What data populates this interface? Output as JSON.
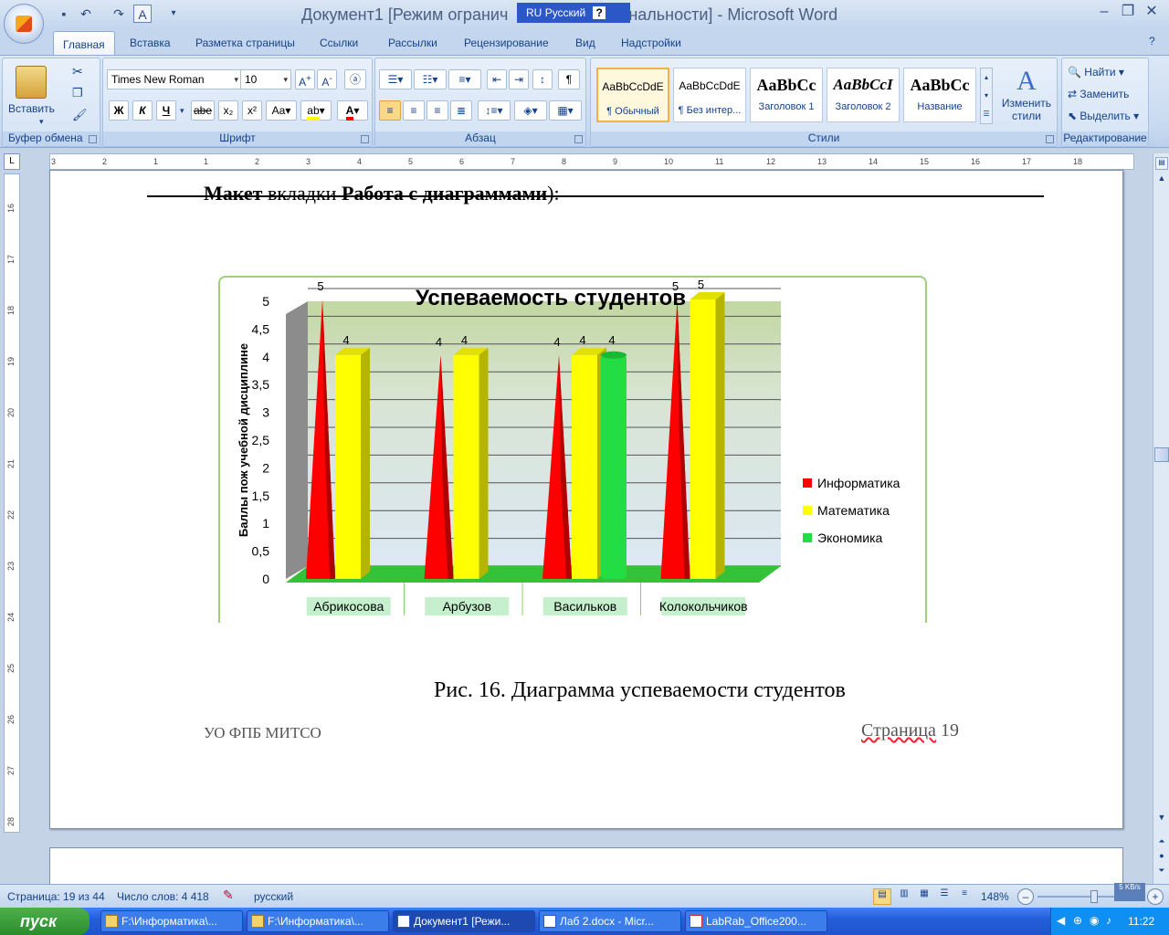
{
  "titlebar": {
    "document_title": "Документ1 [Режим ограниченной функциональности] - Microsoft Word",
    "title_part1": "Документ1 [Режим огранич",
    "title_part2": "ональности]  -  Microsoft Word",
    "lang_code": "RU",
    "lang_name": "Русский",
    "help_glyph": "?"
  },
  "tabs": [
    "Главная",
    "Вставка",
    "Разметка страницы",
    "Ссылки",
    "Рассылки",
    "Рецензирование",
    "Вид",
    "Надстройки"
  ],
  "ribbon": {
    "clipboard": {
      "label": "Буфер обмена",
      "paste": "Вставить"
    },
    "font": {
      "label": "Шрифт",
      "family": "Times New Roman",
      "size": "10",
      "bold": "Ж",
      "italic": "К",
      "underline": "Ч",
      "strike": "abe",
      "sub": "x₂",
      "sup": "x²",
      "case": "Aa"
    },
    "paragraph": {
      "label": "Абзац",
      "pilcrow": "¶"
    },
    "styles": {
      "label": "Стили",
      "items": [
        {
          "sample": "AaBbCcDdE",
          "name": "¶ Обычный"
        },
        {
          "sample": "AaBbCcDdE",
          "name": "¶ Без интер..."
        },
        {
          "sample": "AaBbCc",
          "name": "Заголовок 1"
        },
        {
          "sample": "AaBbCcI",
          "name": "Заголовок 2"
        },
        {
          "sample": "AaBbCc",
          "name": "Название"
        }
      ],
      "change": "Изменить стили"
    },
    "editing": {
      "label": "Редактирование",
      "find": "Найти",
      "replace": "Заменить",
      "select": "Выделить"
    }
  },
  "ruler": {
    "h_labels": [
      "3",
      "2",
      "1",
      "1",
      "2",
      "3",
      "4",
      "5",
      "6",
      "7",
      "8",
      "9",
      "10",
      "11",
      "12",
      "13",
      "14",
      "15",
      "16",
      "17",
      "18"
    ],
    "v_labels": [
      "16",
      "17",
      "18",
      "19",
      "20",
      "21",
      "22",
      "23",
      "24",
      "25",
      "26",
      "27",
      "28"
    ]
  },
  "document": {
    "heading_bold1": "Макет",
    "heading_mid": " вкладки ",
    "heading_bold2": "Работа с диаграммами",
    "heading_end": "):",
    "caption": "Рис. 16. Диаграмма успеваемости студентов",
    "footer_left": "УО ФПБ МИТСО",
    "footer_right_word": "Страница",
    "footer_right_num": " 19"
  },
  "chart_data": {
    "type": "bar",
    "title": "Успеваемость студентов",
    "ylabel": "Баллы пож учебной дисциплине",
    "xlabel": "",
    "categories": [
      "Абрикосова",
      "Арбузов",
      "Васильков",
      "Колокольчиков"
    ],
    "series": [
      {
        "name": "Информатика",
        "values": [
          5,
          4,
          4,
          5
        ],
        "color": "#ff0000"
      },
      {
        "name": "Математика",
        "values": [
          4,
          4,
          4,
          5
        ],
        "color": "#ffff00"
      },
      {
        "name": "Экономика",
        "values": [
          null,
          null,
          4,
          null
        ],
        "color": "#22dd44"
      }
    ],
    "ylim": [
      0,
      5
    ],
    "yticks": [
      "0",
      "0,5",
      "1",
      "1,5",
      "2",
      "2,5",
      "3",
      "3,5",
      "4",
      "4,5",
      "5"
    ],
    "legend_position": "right",
    "grid": true
  },
  "statusbar": {
    "page": "Страница: 19 из 44",
    "words": "Число слов: 4 418",
    "language": "русский",
    "zoom": "148%",
    "net": "5 KB/s"
  },
  "taskbar": {
    "start": "пуск",
    "tasks": [
      "F:\\Информатика\\...",
      "F:\\Информатика\\...",
      "Документ1 [Режи...",
      "Лаб 2.docx - Micr...",
      "LabRab_Office200..."
    ],
    "clock": "11:22"
  }
}
